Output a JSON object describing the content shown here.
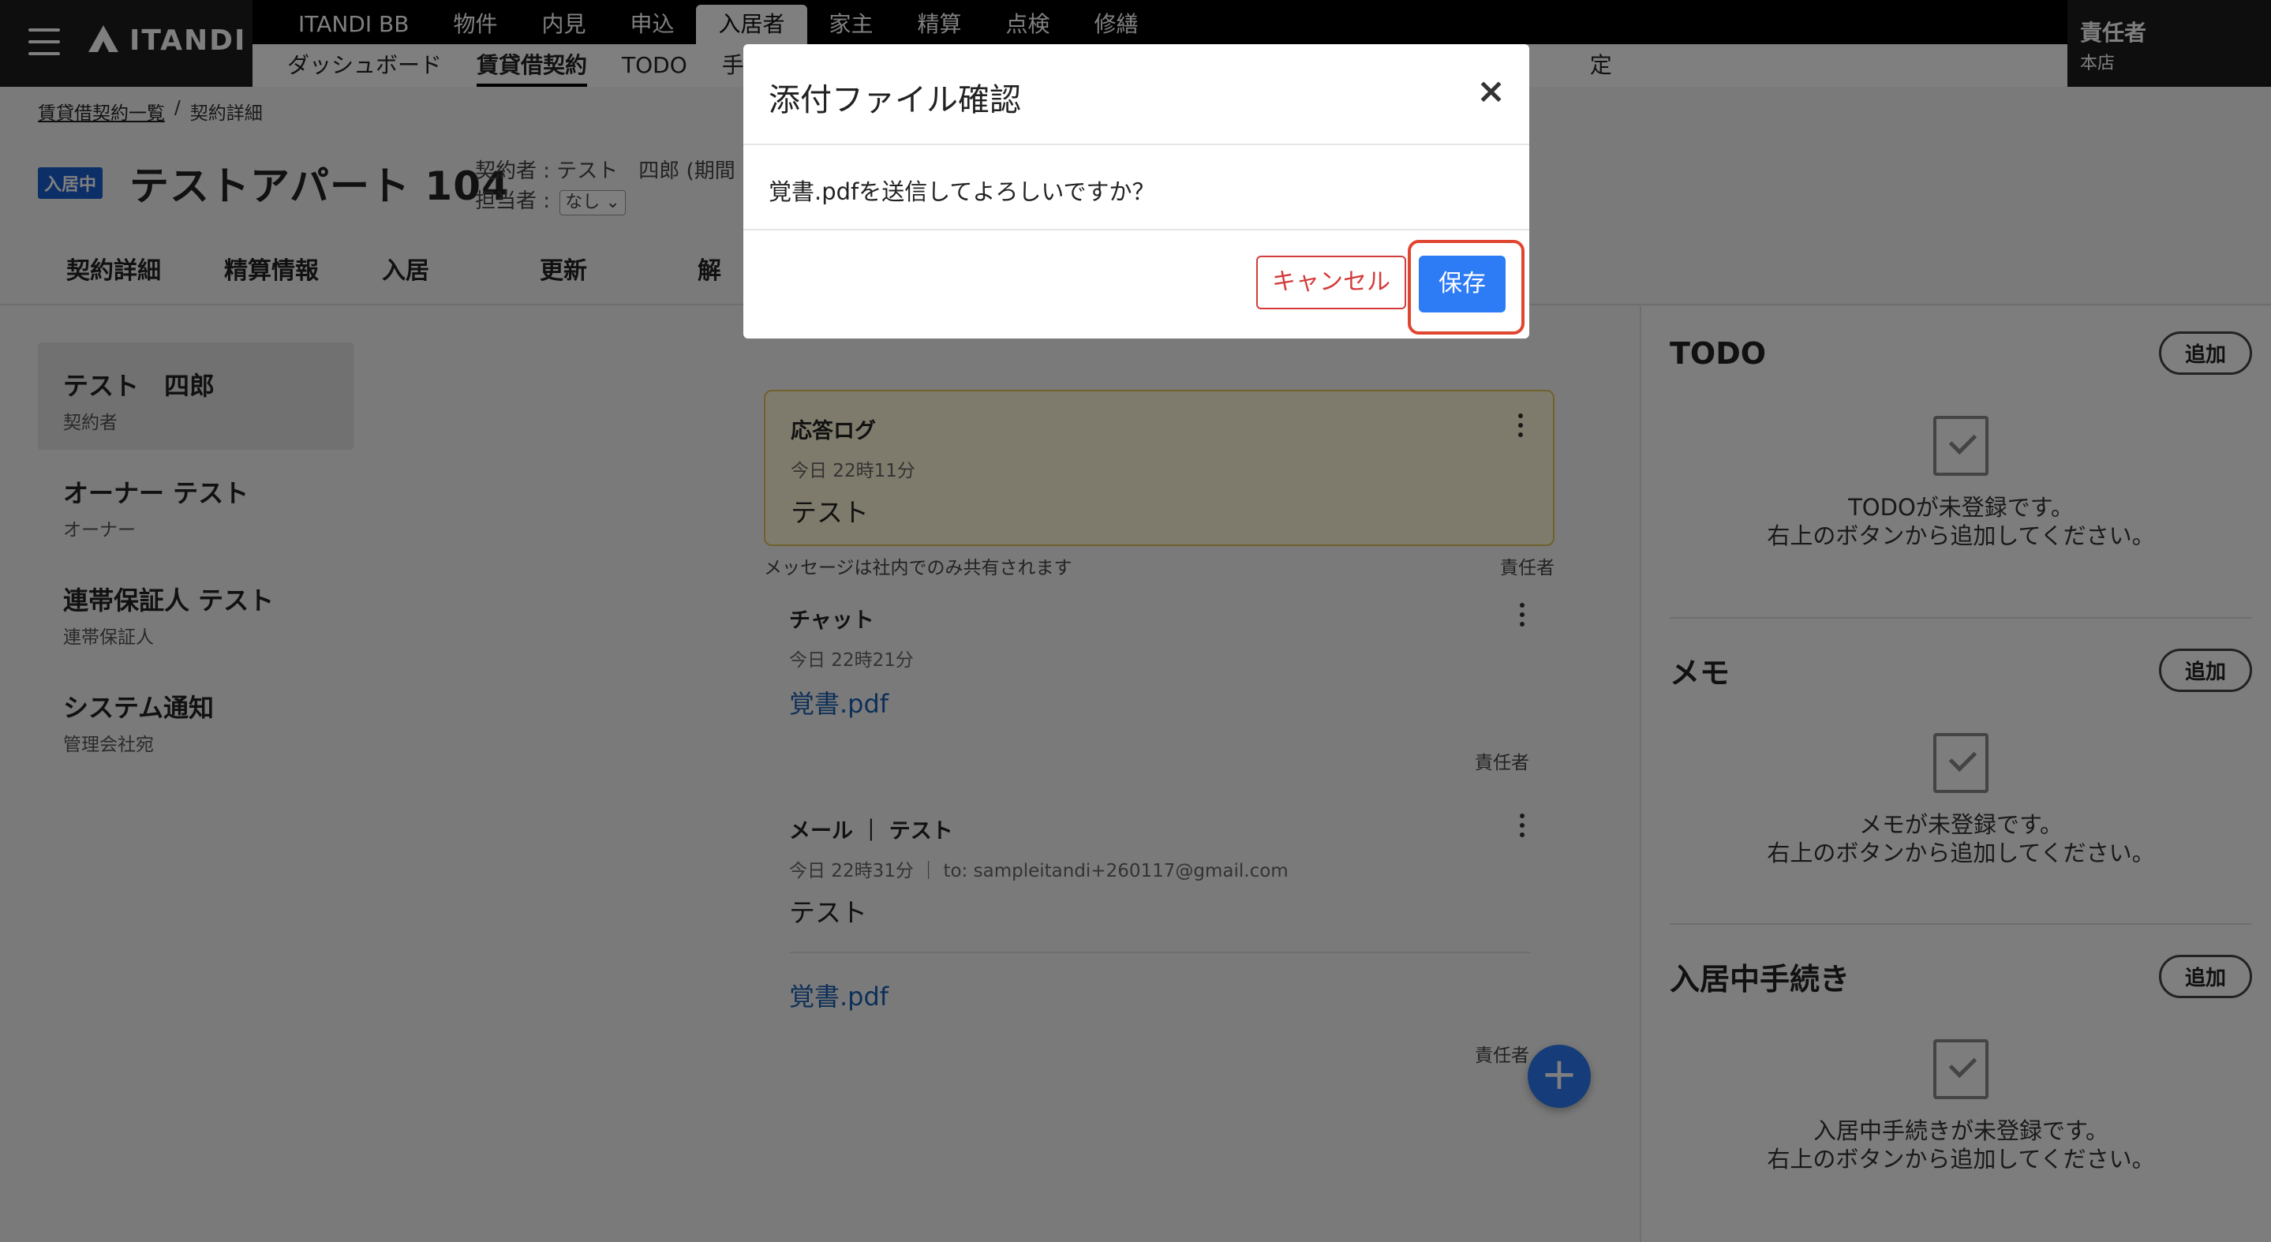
{
  "brand": {
    "logo_text": "ITANDI"
  },
  "nav_main": [
    "ITANDI BB",
    "物件",
    "内見",
    "申込",
    "入居者",
    "家主",
    "精算",
    "点検",
    "修繕"
  ],
  "nav_main_active": "入居者",
  "nav_sub": [
    "ダッシュボード",
    "賃貸借契約",
    "TODO",
    "手続"
  ],
  "nav_sub_active": "賃貸借契約",
  "nav_sub_hidden_tail": "定",
  "user": {
    "name": "責任者",
    "store": "本店"
  },
  "breadcrumb": {
    "link": "賃貸借契約一覧",
    "separator": "/",
    "current": "契約詳細"
  },
  "header": {
    "status_badge": "入居中",
    "title": "テストアパート 104",
    "contractor_line": "契約者 : テスト　四郎 (期間",
    "assignee_label": "担当者 :",
    "assignee_value": "なし"
  },
  "tabs": [
    "契約詳細",
    "精算情報",
    "入居",
    "更新",
    "解"
  ],
  "parties": [
    {
      "name": "テスト　四郎",
      "role": "契約者"
    },
    {
      "name": "オーナー テスト",
      "role": "オーナー"
    },
    {
      "name": "連帯保証人 テスト",
      "role": "連帯保証人"
    },
    {
      "name": "システム通知",
      "role": "管理会社宛"
    }
  ],
  "log": {
    "card": {
      "title": "応答ログ",
      "time": "今日 22時11分",
      "body": "テスト"
    },
    "footer_note": "メッセージは社内でのみ共有されます",
    "footer_sender": "責任者",
    "chat": {
      "title": "チャット",
      "time": "今日 22時21分",
      "attachment": "覚書.pdf",
      "sender": "責任者"
    },
    "mail": {
      "title": "メール ｜ テスト",
      "time": "今日 22時31分 ｜ to: sampleitandi+260117@gmail.com",
      "body": "テスト",
      "attachment": "覚書.pdf",
      "sender": "責任者"
    }
  },
  "fab": {
    "icon": "plus-icon",
    "label": "+"
  },
  "right_panel": {
    "todo": {
      "title": "TODO",
      "add_label": "追加",
      "empty_line1": "TODOが未登録です。",
      "empty_line2": "右上のボタンから追加してください。"
    },
    "memo": {
      "title": "メモ",
      "add_label": "追加",
      "empty_line1": "メモが未登録です。",
      "empty_line2": "右上のボタンから追加してください。"
    },
    "procedure": {
      "title": "入居中手続き",
      "add_label": "追加",
      "empty_line1": "入居中手続きが未登録です。",
      "empty_line2": "右上のボタンから追加してください。"
    }
  },
  "modal": {
    "title": "添付ファイル確認",
    "close_label": "×",
    "message": "覚書.pdfを送信してよろしいですか？",
    "cancel_label": "キャンセル",
    "save_label": "保存"
  },
  "colors": {
    "accent": "#2d7bf5",
    "cancel": "#d43b3b",
    "highlight": "#e0452f",
    "badge": "#1a5fd1",
    "log_card_bg": "#fff6d8"
  }
}
